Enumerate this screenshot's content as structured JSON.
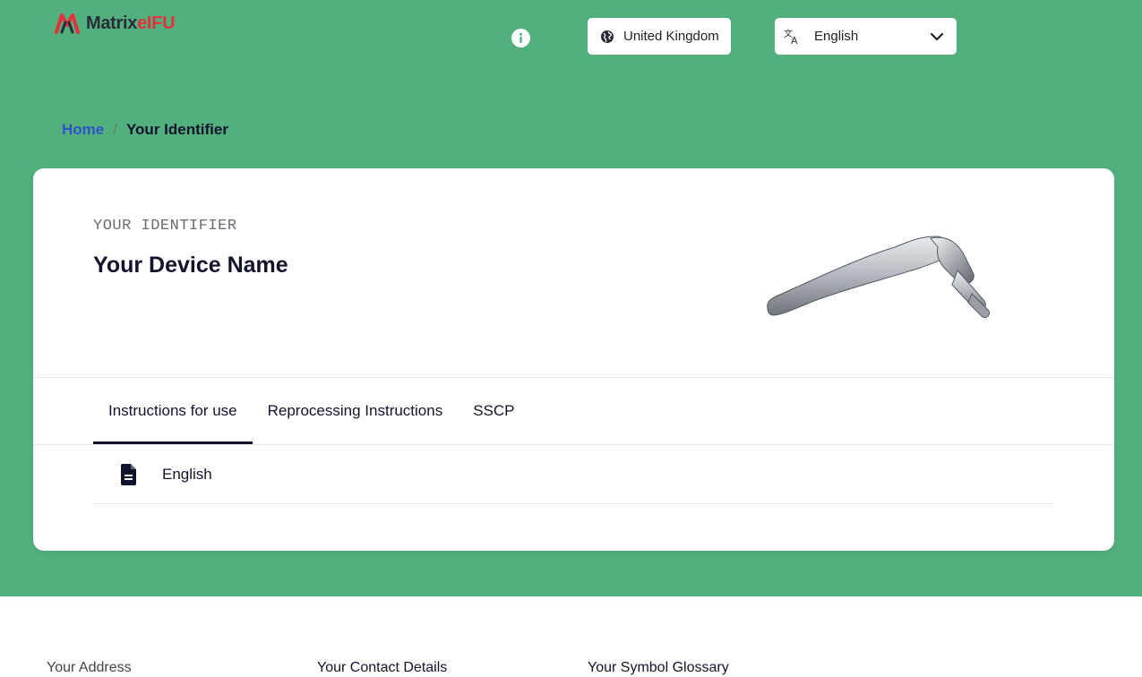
{
  "brand": {
    "part1": "Matrix",
    "part2": "eIFU",
    "mark_colors": [
      "#e2313c",
      "#2b2b3a"
    ]
  },
  "header": {
    "info_icon": "info-icon",
    "country": {
      "icon": "globe-icon",
      "label": "United Kingdom"
    },
    "language": {
      "icon": "translate-icon",
      "label": "English",
      "chevron": "chevron-down-icon"
    }
  },
  "breadcrumb": {
    "home": "Home",
    "separator": "/",
    "current": "Your Identifier"
  },
  "device": {
    "identifier": "YOUR IDENTIFIER",
    "name": "Your Device Name"
  },
  "tabs": [
    {
      "label": "Instructions for use",
      "active": true
    },
    {
      "label": "Reprocessing Instructions",
      "active": false
    },
    {
      "label": "SSCP",
      "active": false
    }
  ],
  "documents": [
    {
      "icon": "document-icon",
      "label": "English"
    }
  ],
  "footer": {
    "address": "Your Address",
    "contact": "Your Contact Details",
    "glossary": "Your Symbol Glossary"
  },
  "colors": {
    "hero_bg": "#52b07d",
    "link": "#2f54c7",
    "text": "#13132b"
  }
}
